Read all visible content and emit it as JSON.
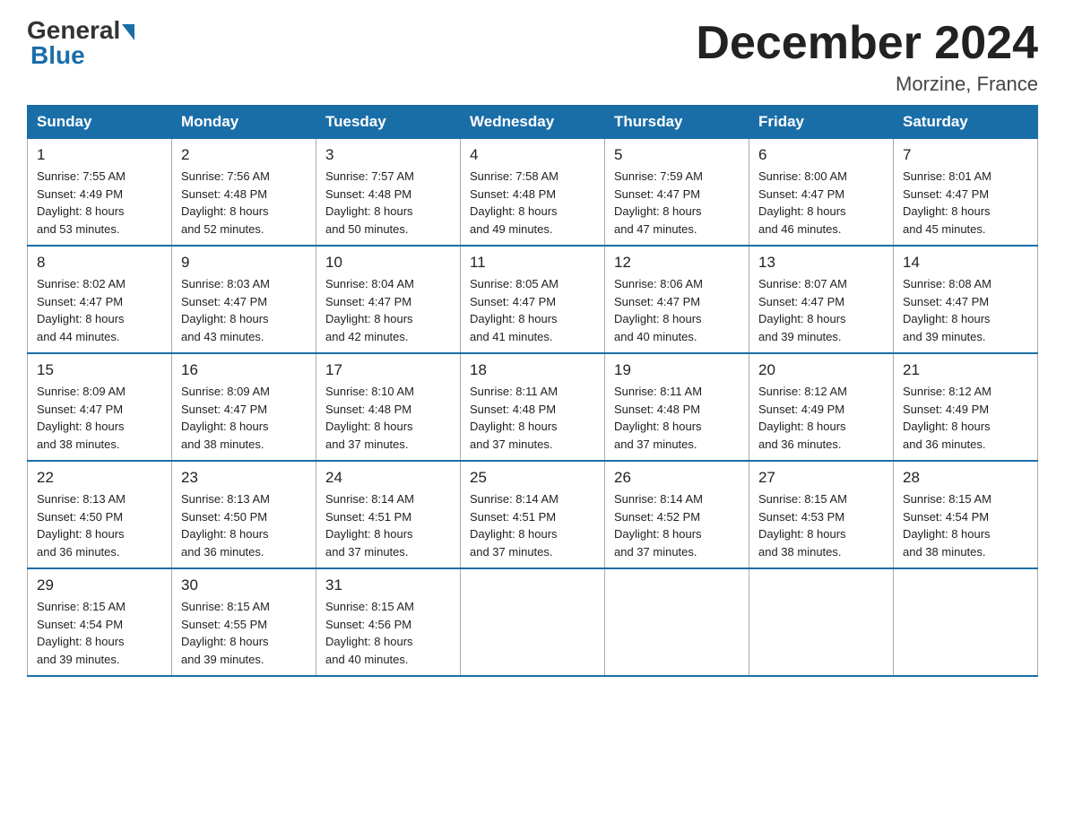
{
  "header": {
    "logo_general": "General",
    "logo_blue": "Blue",
    "month_title": "December 2024",
    "location": "Morzine, France"
  },
  "days_of_week": [
    "Sunday",
    "Monday",
    "Tuesday",
    "Wednesday",
    "Thursday",
    "Friday",
    "Saturday"
  ],
  "weeks": [
    [
      {
        "day": "1",
        "sunrise": "7:55 AM",
        "sunset": "4:49 PM",
        "daylight": "8 hours and 53 minutes."
      },
      {
        "day": "2",
        "sunrise": "7:56 AM",
        "sunset": "4:48 PM",
        "daylight": "8 hours and 52 minutes."
      },
      {
        "day": "3",
        "sunrise": "7:57 AM",
        "sunset": "4:48 PM",
        "daylight": "8 hours and 50 minutes."
      },
      {
        "day": "4",
        "sunrise": "7:58 AM",
        "sunset": "4:48 PM",
        "daylight": "8 hours and 49 minutes."
      },
      {
        "day": "5",
        "sunrise": "7:59 AM",
        "sunset": "4:47 PM",
        "daylight": "8 hours and 47 minutes."
      },
      {
        "day": "6",
        "sunrise": "8:00 AM",
        "sunset": "4:47 PM",
        "daylight": "8 hours and 46 minutes."
      },
      {
        "day": "7",
        "sunrise": "8:01 AM",
        "sunset": "4:47 PM",
        "daylight": "8 hours and 45 minutes."
      }
    ],
    [
      {
        "day": "8",
        "sunrise": "8:02 AM",
        "sunset": "4:47 PM",
        "daylight": "8 hours and 44 minutes."
      },
      {
        "day": "9",
        "sunrise": "8:03 AM",
        "sunset": "4:47 PM",
        "daylight": "8 hours and 43 minutes."
      },
      {
        "day": "10",
        "sunrise": "8:04 AM",
        "sunset": "4:47 PM",
        "daylight": "8 hours and 42 minutes."
      },
      {
        "day": "11",
        "sunrise": "8:05 AM",
        "sunset": "4:47 PM",
        "daylight": "8 hours and 41 minutes."
      },
      {
        "day": "12",
        "sunrise": "8:06 AM",
        "sunset": "4:47 PM",
        "daylight": "8 hours and 40 minutes."
      },
      {
        "day": "13",
        "sunrise": "8:07 AM",
        "sunset": "4:47 PM",
        "daylight": "8 hours and 39 minutes."
      },
      {
        "day": "14",
        "sunrise": "8:08 AM",
        "sunset": "4:47 PM",
        "daylight": "8 hours and 39 minutes."
      }
    ],
    [
      {
        "day": "15",
        "sunrise": "8:09 AM",
        "sunset": "4:47 PM",
        "daylight": "8 hours and 38 minutes."
      },
      {
        "day": "16",
        "sunrise": "8:09 AM",
        "sunset": "4:47 PM",
        "daylight": "8 hours and 38 minutes."
      },
      {
        "day": "17",
        "sunrise": "8:10 AM",
        "sunset": "4:48 PM",
        "daylight": "8 hours and 37 minutes."
      },
      {
        "day": "18",
        "sunrise": "8:11 AM",
        "sunset": "4:48 PM",
        "daylight": "8 hours and 37 minutes."
      },
      {
        "day": "19",
        "sunrise": "8:11 AM",
        "sunset": "4:48 PM",
        "daylight": "8 hours and 37 minutes."
      },
      {
        "day": "20",
        "sunrise": "8:12 AM",
        "sunset": "4:49 PM",
        "daylight": "8 hours and 36 minutes."
      },
      {
        "day": "21",
        "sunrise": "8:12 AM",
        "sunset": "4:49 PM",
        "daylight": "8 hours and 36 minutes."
      }
    ],
    [
      {
        "day": "22",
        "sunrise": "8:13 AM",
        "sunset": "4:50 PM",
        "daylight": "8 hours and 36 minutes."
      },
      {
        "day": "23",
        "sunrise": "8:13 AM",
        "sunset": "4:50 PM",
        "daylight": "8 hours and 36 minutes."
      },
      {
        "day": "24",
        "sunrise": "8:14 AM",
        "sunset": "4:51 PM",
        "daylight": "8 hours and 37 minutes."
      },
      {
        "day": "25",
        "sunrise": "8:14 AM",
        "sunset": "4:51 PM",
        "daylight": "8 hours and 37 minutes."
      },
      {
        "day": "26",
        "sunrise": "8:14 AM",
        "sunset": "4:52 PM",
        "daylight": "8 hours and 37 minutes."
      },
      {
        "day": "27",
        "sunrise": "8:15 AM",
        "sunset": "4:53 PM",
        "daylight": "8 hours and 38 minutes."
      },
      {
        "day": "28",
        "sunrise": "8:15 AM",
        "sunset": "4:54 PM",
        "daylight": "8 hours and 38 minutes."
      }
    ],
    [
      {
        "day": "29",
        "sunrise": "8:15 AM",
        "sunset": "4:54 PM",
        "daylight": "8 hours and 39 minutes."
      },
      {
        "day": "30",
        "sunrise": "8:15 AM",
        "sunset": "4:55 PM",
        "daylight": "8 hours and 39 minutes."
      },
      {
        "day": "31",
        "sunrise": "8:15 AM",
        "sunset": "4:56 PM",
        "daylight": "8 hours and 40 minutes."
      },
      null,
      null,
      null,
      null
    ]
  ],
  "labels": {
    "sunrise": "Sunrise:",
    "sunset": "Sunset:",
    "daylight": "Daylight:"
  }
}
